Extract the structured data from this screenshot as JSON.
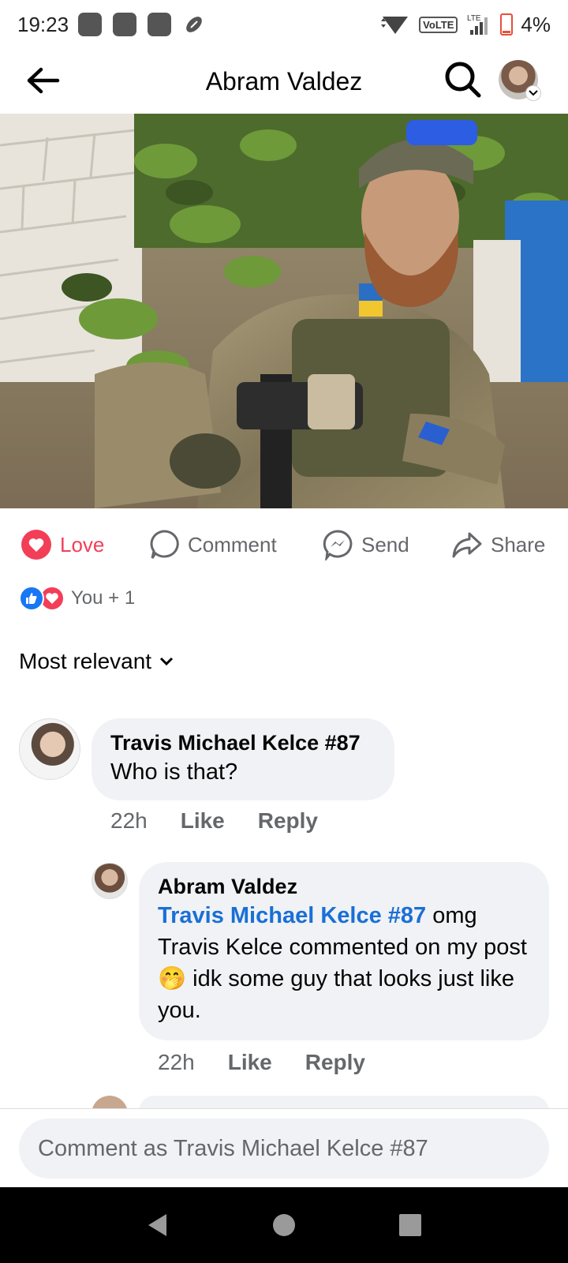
{
  "status_bar": {
    "time": "19:23",
    "network": "VoLTE",
    "lte": "LTE",
    "battery": "4%"
  },
  "header": {
    "title": "Abram Valdez"
  },
  "actions": {
    "love": "Love",
    "comment": "Comment",
    "send": "Send",
    "share": "Share"
  },
  "reactions": {
    "count_text": "You + 1"
  },
  "sort": {
    "label": "Most relevant"
  },
  "comments": [
    {
      "author": "Travis Michael Kelce #87",
      "text": "Who is that?",
      "time": "22h",
      "like": "Like",
      "reply": "Reply"
    }
  ],
  "reply": {
    "author": "Abram Valdez",
    "mention": "Travis Michael Kelce #87",
    "text_1": " omg Travis Kelce commented on my post",
    "emoji": "🤭",
    "text_2": " idk some guy that looks just like you.",
    "time": "22h",
    "like": "Like",
    "reply": "Reply"
  },
  "composer": {
    "placeholder": "Comment as Travis Michael Kelce #87"
  },
  "colors": {
    "love": "#f33e58",
    "link": "#1a6fd6",
    "bubble": "#f0f2f5",
    "secondary_text": "#65676b"
  }
}
